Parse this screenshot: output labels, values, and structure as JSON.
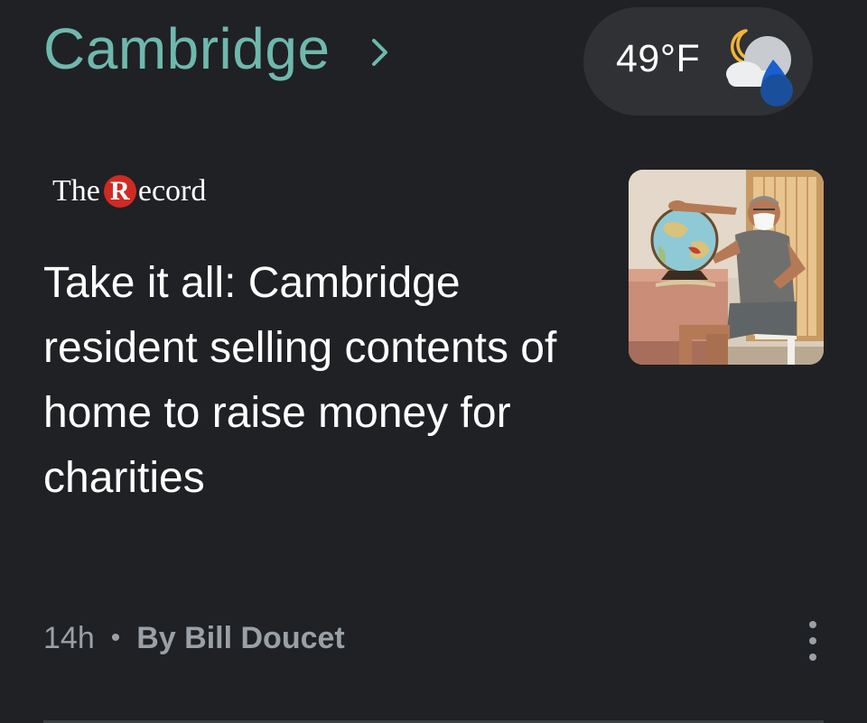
{
  "header": {
    "location": "Cambridge",
    "chevron_icon": "chevron-right-icon"
  },
  "weather": {
    "temperature": "49°F",
    "condition_icon": "partly-cloudy-night-rain-icon"
  },
  "article": {
    "publisher": {
      "prefix": "The",
      "initial": "R",
      "suffix": "ecord",
      "accent_color": "#d02a25"
    },
    "headline": "Take it all: Cambridge resident selling contents of home to raise money for charities",
    "thumbnail_icon": "man-holding-globe-photo",
    "age": "14h",
    "separator": "•",
    "byline": "By Bill Doucet",
    "more_icon": "more-vert-icon"
  },
  "colors": {
    "background": "#202124",
    "location_accent": "#6fb8ae",
    "pill_background": "#303134",
    "meta_text": "#9aa0a6"
  }
}
